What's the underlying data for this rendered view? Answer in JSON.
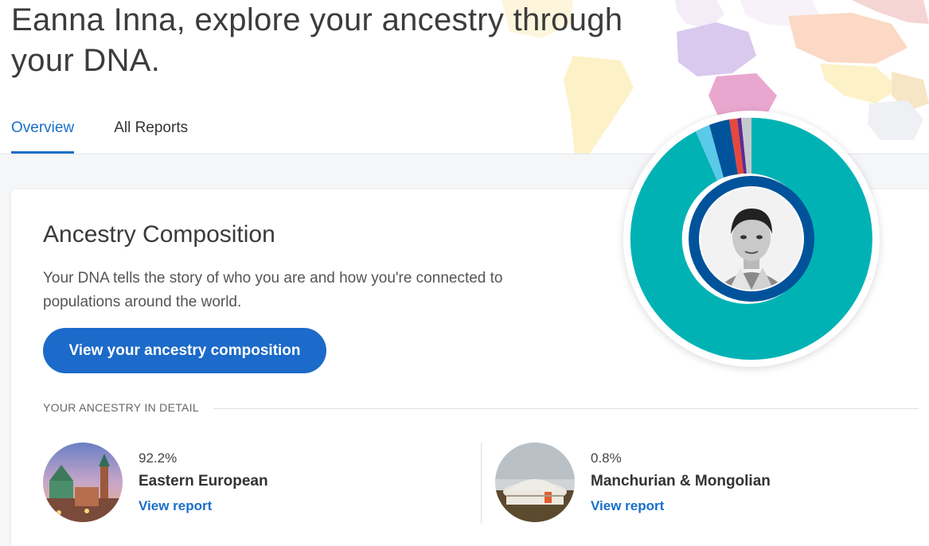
{
  "header": {
    "headline": "Eanna Inna, explore your ancestry through your DNA."
  },
  "tabs": [
    {
      "label": "Overview",
      "active": true
    },
    {
      "label": "All Reports",
      "active": false
    }
  ],
  "card": {
    "title": "Ancestry Composition",
    "description": "Your DNA tells the story of who you are and how you're connected to populations around the world.",
    "cta_label": "View your ancestry composition",
    "detail_heading": "YOUR ANCESTRY IN DETAIL"
  },
  "populations": [
    {
      "percent": "92.2%",
      "name": "Eastern European",
      "link": "View report"
    },
    {
      "percent": "0.8%",
      "name": "Manchurian & Mongolian",
      "link": "View report"
    }
  ],
  "colors": {
    "accent": "#1c6ac9",
    "donut_main": "#00b2b4",
    "donut_inner": "#00539b"
  }
}
